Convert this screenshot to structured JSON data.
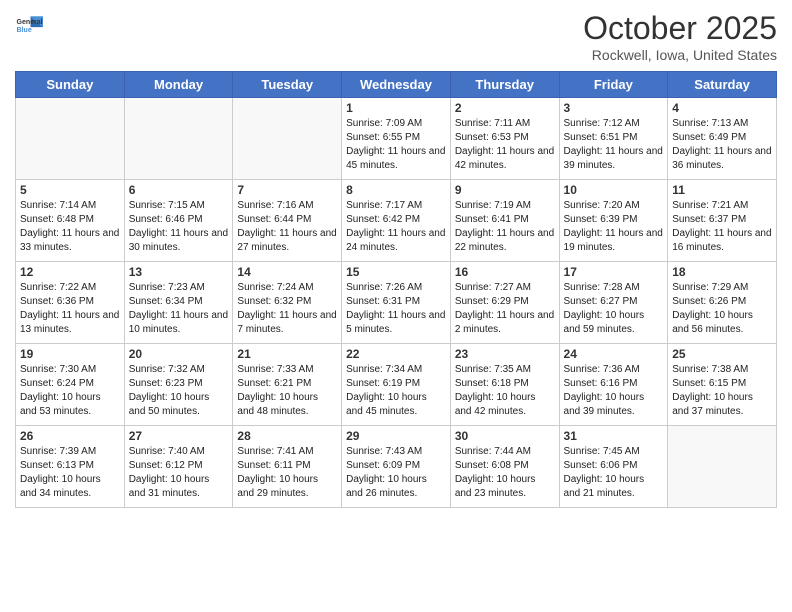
{
  "header": {
    "logo_general": "General",
    "logo_blue": "Blue",
    "month": "October 2025",
    "location": "Rockwell, Iowa, United States"
  },
  "days_of_week": [
    "Sunday",
    "Monday",
    "Tuesday",
    "Wednesday",
    "Thursday",
    "Friday",
    "Saturday"
  ],
  "weeks": [
    [
      {
        "day": "",
        "text": ""
      },
      {
        "day": "",
        "text": ""
      },
      {
        "day": "",
        "text": ""
      },
      {
        "day": "1",
        "text": "Sunrise: 7:09 AM\nSunset: 6:55 PM\nDaylight: 11 hours and 45 minutes."
      },
      {
        "day": "2",
        "text": "Sunrise: 7:11 AM\nSunset: 6:53 PM\nDaylight: 11 hours and 42 minutes."
      },
      {
        "day": "3",
        "text": "Sunrise: 7:12 AM\nSunset: 6:51 PM\nDaylight: 11 hours and 39 minutes."
      },
      {
        "day": "4",
        "text": "Sunrise: 7:13 AM\nSunset: 6:49 PM\nDaylight: 11 hours and 36 minutes."
      }
    ],
    [
      {
        "day": "5",
        "text": "Sunrise: 7:14 AM\nSunset: 6:48 PM\nDaylight: 11 hours and 33 minutes."
      },
      {
        "day": "6",
        "text": "Sunrise: 7:15 AM\nSunset: 6:46 PM\nDaylight: 11 hours and 30 minutes."
      },
      {
        "day": "7",
        "text": "Sunrise: 7:16 AM\nSunset: 6:44 PM\nDaylight: 11 hours and 27 minutes."
      },
      {
        "day": "8",
        "text": "Sunrise: 7:17 AM\nSunset: 6:42 PM\nDaylight: 11 hours and 24 minutes."
      },
      {
        "day": "9",
        "text": "Sunrise: 7:19 AM\nSunset: 6:41 PM\nDaylight: 11 hours and 22 minutes."
      },
      {
        "day": "10",
        "text": "Sunrise: 7:20 AM\nSunset: 6:39 PM\nDaylight: 11 hours and 19 minutes."
      },
      {
        "day": "11",
        "text": "Sunrise: 7:21 AM\nSunset: 6:37 PM\nDaylight: 11 hours and 16 minutes."
      }
    ],
    [
      {
        "day": "12",
        "text": "Sunrise: 7:22 AM\nSunset: 6:36 PM\nDaylight: 11 hours and 13 minutes."
      },
      {
        "day": "13",
        "text": "Sunrise: 7:23 AM\nSunset: 6:34 PM\nDaylight: 11 hours and 10 minutes."
      },
      {
        "day": "14",
        "text": "Sunrise: 7:24 AM\nSunset: 6:32 PM\nDaylight: 11 hours and 7 minutes."
      },
      {
        "day": "15",
        "text": "Sunrise: 7:26 AM\nSunset: 6:31 PM\nDaylight: 11 hours and 5 minutes."
      },
      {
        "day": "16",
        "text": "Sunrise: 7:27 AM\nSunset: 6:29 PM\nDaylight: 11 hours and 2 minutes."
      },
      {
        "day": "17",
        "text": "Sunrise: 7:28 AM\nSunset: 6:27 PM\nDaylight: 10 hours and 59 minutes."
      },
      {
        "day": "18",
        "text": "Sunrise: 7:29 AM\nSunset: 6:26 PM\nDaylight: 10 hours and 56 minutes."
      }
    ],
    [
      {
        "day": "19",
        "text": "Sunrise: 7:30 AM\nSunset: 6:24 PM\nDaylight: 10 hours and 53 minutes."
      },
      {
        "day": "20",
        "text": "Sunrise: 7:32 AM\nSunset: 6:23 PM\nDaylight: 10 hours and 50 minutes."
      },
      {
        "day": "21",
        "text": "Sunrise: 7:33 AM\nSunset: 6:21 PM\nDaylight: 10 hours and 48 minutes."
      },
      {
        "day": "22",
        "text": "Sunrise: 7:34 AM\nSunset: 6:19 PM\nDaylight: 10 hours and 45 minutes."
      },
      {
        "day": "23",
        "text": "Sunrise: 7:35 AM\nSunset: 6:18 PM\nDaylight: 10 hours and 42 minutes."
      },
      {
        "day": "24",
        "text": "Sunrise: 7:36 AM\nSunset: 6:16 PM\nDaylight: 10 hours and 39 minutes."
      },
      {
        "day": "25",
        "text": "Sunrise: 7:38 AM\nSunset: 6:15 PM\nDaylight: 10 hours and 37 minutes."
      }
    ],
    [
      {
        "day": "26",
        "text": "Sunrise: 7:39 AM\nSunset: 6:13 PM\nDaylight: 10 hours and 34 minutes."
      },
      {
        "day": "27",
        "text": "Sunrise: 7:40 AM\nSunset: 6:12 PM\nDaylight: 10 hours and 31 minutes."
      },
      {
        "day": "28",
        "text": "Sunrise: 7:41 AM\nSunset: 6:11 PM\nDaylight: 10 hours and 29 minutes."
      },
      {
        "day": "29",
        "text": "Sunrise: 7:43 AM\nSunset: 6:09 PM\nDaylight: 10 hours and 26 minutes."
      },
      {
        "day": "30",
        "text": "Sunrise: 7:44 AM\nSunset: 6:08 PM\nDaylight: 10 hours and 23 minutes."
      },
      {
        "day": "31",
        "text": "Sunrise: 7:45 AM\nSunset: 6:06 PM\nDaylight: 10 hours and 21 minutes."
      },
      {
        "day": "",
        "text": ""
      }
    ]
  ]
}
